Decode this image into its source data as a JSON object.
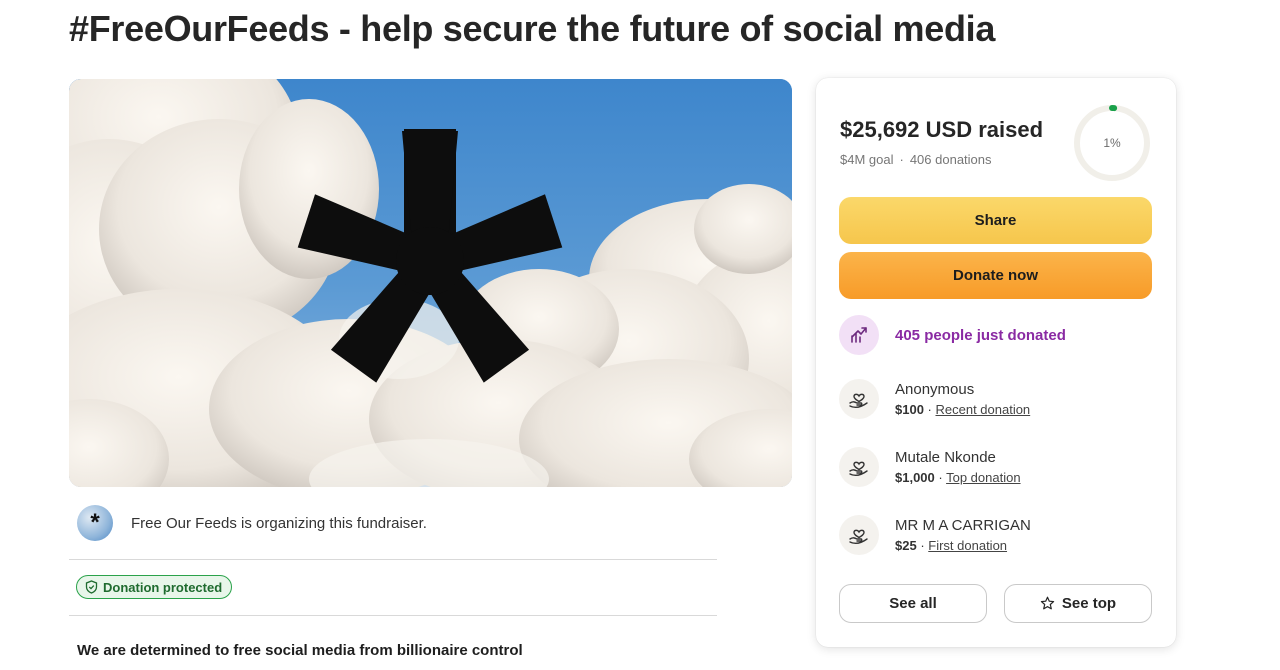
{
  "page": {
    "title": "#FreeOurFeeds - help secure the future of social media"
  },
  "organizer": {
    "text": "Free Our Feeds is organizing this fundraiser."
  },
  "badge": {
    "label": "Donation protected",
    "color": "#2aa24a"
  },
  "story": {
    "heading": "We are determined to free social media from billionaire control"
  },
  "summary": {
    "raised": "$25,692 USD raised",
    "goal": "$4M goal",
    "separator": "·",
    "donations": "406 donations",
    "progress_label": "1%",
    "progress_fraction": 0.01,
    "progress_color": "#1aa14a"
  },
  "buttons": {
    "share": "Share",
    "donate": "Donate now",
    "see_all": "See all",
    "see_top": "See top"
  },
  "activity": {
    "trend_text": "405 people just donated",
    "accent": "#8a2aa3"
  },
  "donations": [
    {
      "name": "Anonymous",
      "amount": "$100",
      "sep": " · ",
      "type": "Recent donation"
    },
    {
      "name": "Mutale Nkonde",
      "amount": "$1,000",
      "sep": " · ",
      "type": "Top donation"
    },
    {
      "name": "MR M A CARRIGAN",
      "amount": "$25",
      "sep": " · ",
      "type": "First donation"
    }
  ],
  "icons": {
    "trend": "trending-up-icon",
    "donor": "heart-in-hand-icon",
    "shield": "shield-icon",
    "star": "star-icon",
    "hero_symbol": "asterisk-icon"
  }
}
